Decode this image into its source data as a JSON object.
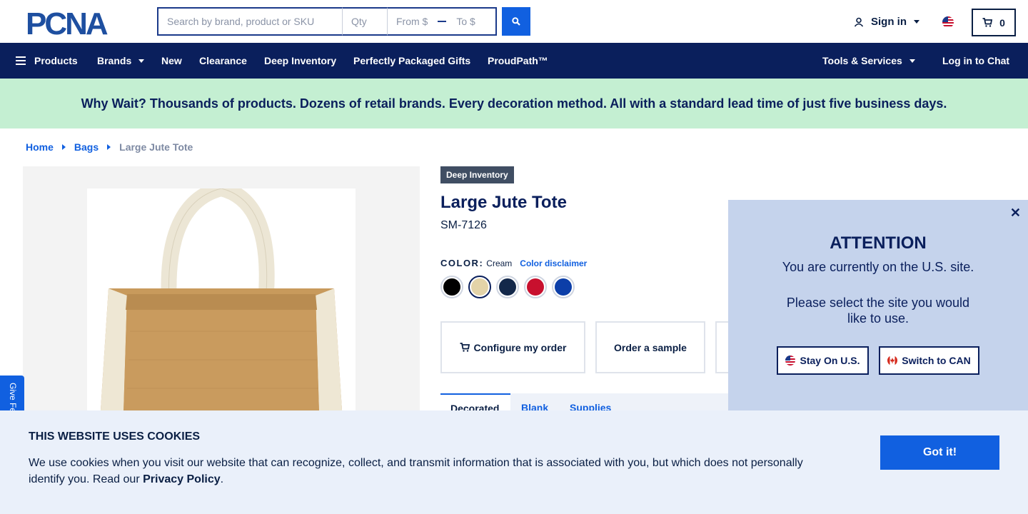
{
  "header": {
    "logo_text": "PCNA",
    "search": {
      "placeholder": "Search by brand, product or SKU",
      "qty_placeholder": "Qty",
      "from_placeholder": "From $",
      "to_placeholder": "To $"
    },
    "signin_label": "Sign in",
    "cart_count": "0"
  },
  "nav": {
    "items": [
      {
        "label": "Products"
      },
      {
        "label": "Brands"
      },
      {
        "label": "New"
      },
      {
        "label": "Clearance"
      },
      {
        "label": "Deep Inventory"
      },
      {
        "label": "Perfectly Packaged Gifts"
      },
      {
        "label": "ProudPath™"
      },
      {
        "label": "Tools & Services"
      },
      {
        "label": "Log in to Chat"
      }
    ]
  },
  "banner": {
    "text": "Why Wait? Thousands of products. Dozens of retail brands. Every decoration method. All with a standard lead time of just five business days."
  },
  "breadcrumb": {
    "items": [
      "Home",
      "Bags"
    ],
    "current": "Large Jute Tote"
  },
  "feedback": {
    "label": "Give Feedback"
  },
  "product": {
    "tag": "Deep Inventory",
    "title": "Large Jute Tote",
    "sku": "SM-7126",
    "color_label": "COLOR:",
    "color_value": "Cream",
    "color_disclaimer": "Color disclaimer",
    "swatches": [
      {
        "name": "Black",
        "hex": "#000000"
      },
      {
        "name": "Cream",
        "hex": "#e3d3a8"
      },
      {
        "name": "Navy",
        "hex": "#13284a"
      },
      {
        "name": "Red",
        "hex": "#c8102e"
      },
      {
        "name": "Royal Blue",
        "hex": "#0c3ea8"
      }
    ],
    "actions": {
      "configure": "Configure my order",
      "sample": "Order a sample"
    },
    "tabs": [
      "Decorated",
      "Blank",
      "Supplies"
    ],
    "tab_visible": [
      "Decorated",
      "Blank — Supplies"
    ]
  },
  "site_popup": {
    "title": "ATTENTION",
    "message_1": "You are currently on the U.S. site.",
    "message_2": "Please select the site you would like to use.",
    "stay_label": "Stay On U.S.",
    "switch_label": "Switch to CAN"
  },
  "cookies": {
    "title": "THIS WEBSITE USES COOKIES",
    "text": "We use cookies when you visit our website that can recognize, collect, and transmit information that is associated with you, but which does not personally identify you. Read our",
    "policy_link": "Privacy Policy",
    "button": "Got it!"
  },
  "colors": {
    "navy": "#0a1f5c",
    "accent_blue": "#1160e0",
    "banner_green": "#c4efd2",
    "popup_bg": "#c5d3ec",
    "cookie_bg": "#eaf0fa"
  }
}
